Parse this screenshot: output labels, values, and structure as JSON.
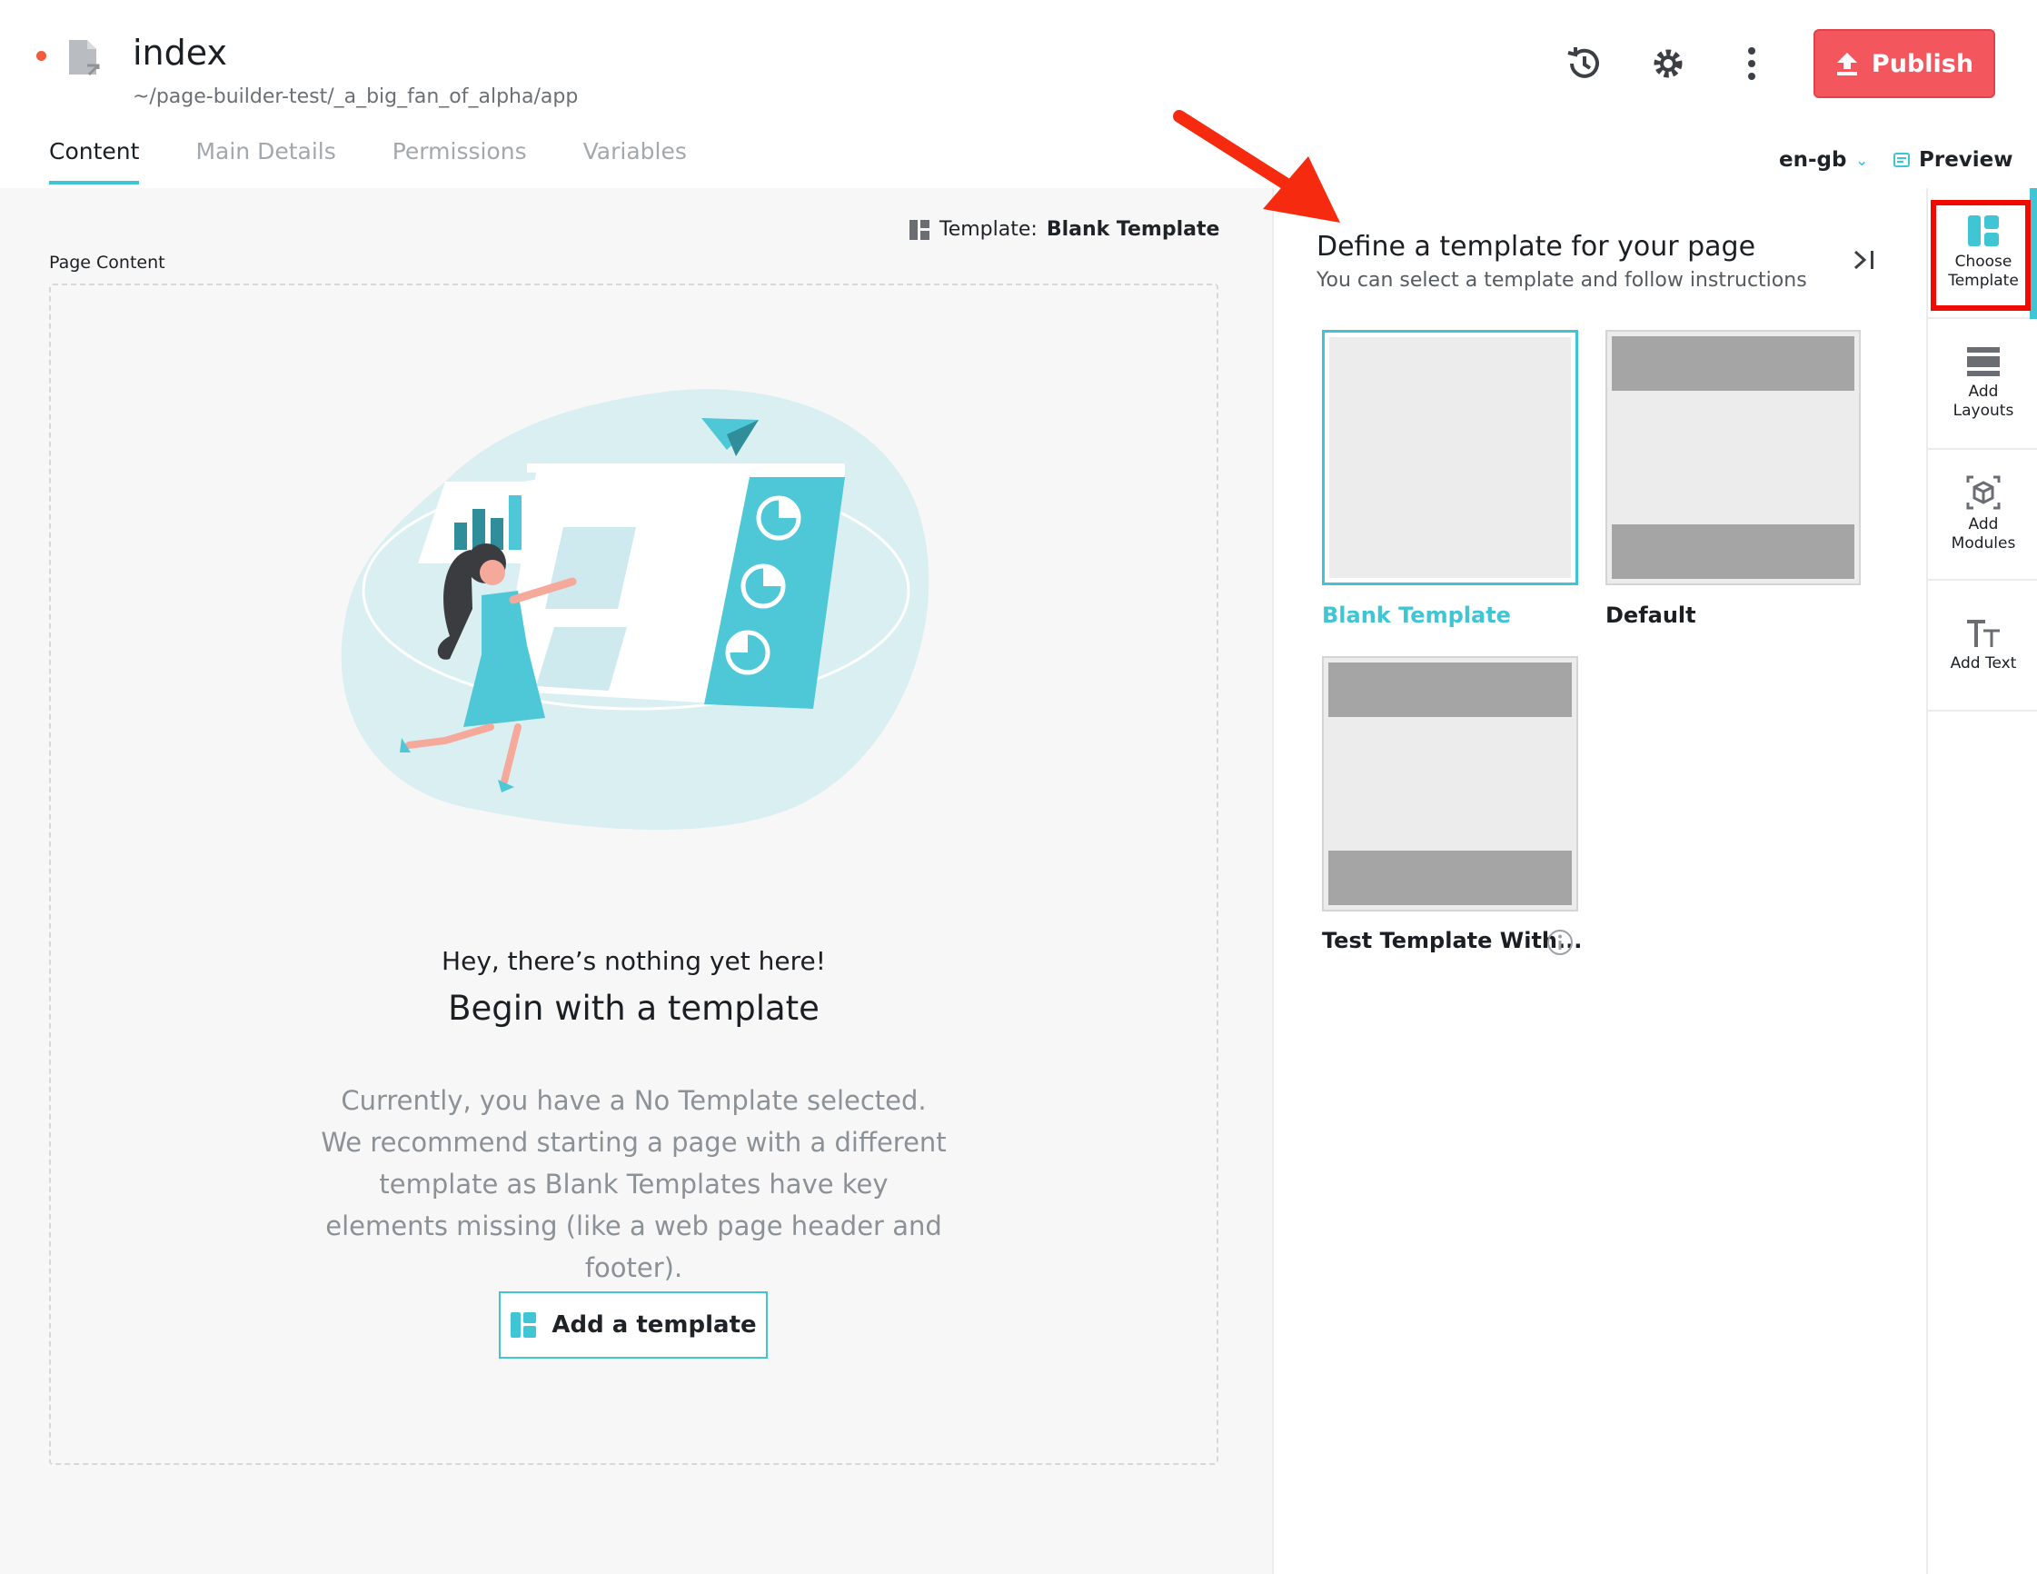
{
  "header": {
    "title": "index",
    "path": "~/page-builder-test/_a_big_fan_of_alpha/app",
    "publish_label": "Publish",
    "status_color": "#f4593f"
  },
  "tabs": [
    {
      "label": "Content",
      "active": true
    },
    {
      "label": "Main Details",
      "active": false
    },
    {
      "label": "Permissions",
      "active": false
    },
    {
      "label": "Variables",
      "active": false
    }
  ],
  "toolbar": {
    "language": "en-gb",
    "preview_label": "Preview"
  },
  "content": {
    "template_prefix": "Template:",
    "template_name": "Blank Template",
    "page_content_label": "Page Content",
    "empty_line1": "Hey, there’s nothing yet here!",
    "empty_line2": "Begin with a template",
    "empty_desc": "Currently, you have a No Template selected. We recommend starting a page with a different template as Blank Templates have key elements missing (like a web page header and footer).",
    "add_template_label": "Add a template"
  },
  "template_panel": {
    "title": "Define a template for your page",
    "subtitle": "You can select a template and follow instructions",
    "templates": [
      {
        "label": "Blank Template",
        "selected": true
      },
      {
        "label": "Default",
        "selected": false
      },
      {
        "label": "Test Template With...",
        "selected": false
      }
    ]
  },
  "sidebar": {
    "items": [
      {
        "label": "Choose Template",
        "icon": "template-icon",
        "active": true
      },
      {
        "label": "Add Layouts",
        "icon": "layouts-icon",
        "active": false
      },
      {
        "label": "Add Modules",
        "icon": "modules-icon",
        "active": false
      },
      {
        "label": "Add Text",
        "icon": "text-icon",
        "active": false
      }
    ]
  },
  "colors": {
    "accent": "#3fc5d4",
    "publish": "#f3565d",
    "annotation": "#f00b00"
  }
}
